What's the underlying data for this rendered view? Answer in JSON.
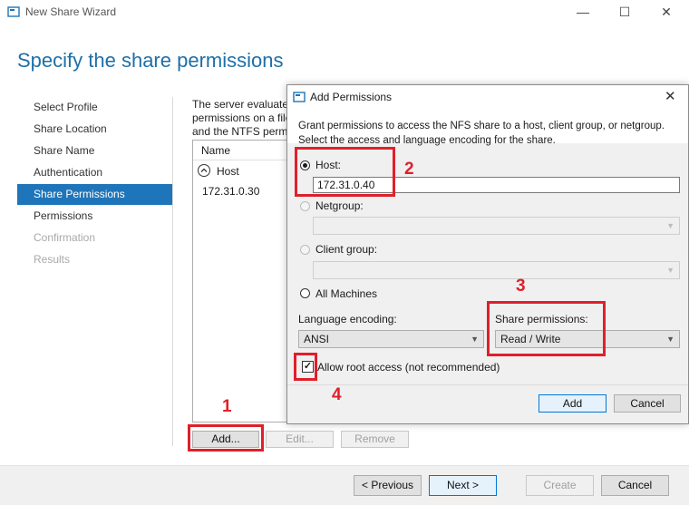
{
  "window": {
    "title": "New Share Wizard"
  },
  "page": {
    "title": "Specify the share permissions",
    "description_lines": [
      "The server evaluates",
      "permissions on a file",
      "and the NTFS permi"
    ]
  },
  "nav": [
    {
      "label": "Select Profile"
    },
    {
      "label": "Share Location"
    },
    {
      "label": "Share Name"
    },
    {
      "label": "Authentication"
    },
    {
      "label": "Share Permissions"
    },
    {
      "label": "Permissions"
    },
    {
      "label": "Confirmation"
    },
    {
      "label": "Results"
    }
  ],
  "list": {
    "header": "Name",
    "group_label": "Host",
    "rows": [
      "172.31.0.30"
    ]
  },
  "list_buttons": {
    "add": "Add...",
    "edit": "Edit...",
    "remove": "Remove"
  },
  "footer": {
    "previous": "< Previous",
    "next": "Next >",
    "create": "Create",
    "cancel": "Cancel"
  },
  "dialog": {
    "title": "Add Permissions",
    "intro_line1": "Grant permissions to access the NFS share to a host, client group, or netgroup.",
    "intro_line2": "Select the access and language encoding for the share.",
    "host_label": "Host:",
    "host_value": "172.31.0.40",
    "netgroup_label": "Netgroup:",
    "client_group_label": "Client group:",
    "all_machines_label": "All Machines",
    "language_label": "Language encoding:",
    "language_value": "ANSI",
    "share_perm_label": "Share permissions:",
    "share_perm_value": "Read / Write",
    "allow_root_label": "Allow root access (not recommended)",
    "add_button": "Add",
    "cancel_button": "Cancel"
  },
  "annotations": {
    "n1": "1",
    "n2": "2",
    "n3": "3",
    "n4": "4"
  },
  "colors": {
    "accent": "#1f75b9",
    "title_blue": "#1e6fa8",
    "annotation_red": "#e01f2a"
  }
}
